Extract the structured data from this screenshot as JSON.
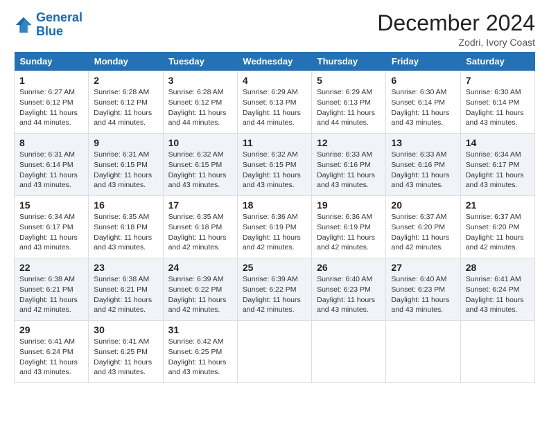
{
  "header": {
    "logo_line1": "General",
    "logo_line2": "Blue",
    "month_title": "December 2024",
    "subtitle": "Zodri, Ivory Coast"
  },
  "weekdays": [
    "Sunday",
    "Monday",
    "Tuesday",
    "Wednesday",
    "Thursday",
    "Friday",
    "Saturday"
  ],
  "weeks": [
    [
      {
        "day": "1",
        "sunrise": "6:27 AM",
        "sunset": "6:12 PM",
        "daylight": "11 hours and 44 minutes."
      },
      {
        "day": "2",
        "sunrise": "6:28 AM",
        "sunset": "6:12 PM",
        "daylight": "11 hours and 44 minutes."
      },
      {
        "day": "3",
        "sunrise": "6:28 AM",
        "sunset": "6:12 PM",
        "daylight": "11 hours and 44 minutes."
      },
      {
        "day": "4",
        "sunrise": "6:29 AM",
        "sunset": "6:13 PM",
        "daylight": "11 hours and 44 minutes."
      },
      {
        "day": "5",
        "sunrise": "6:29 AM",
        "sunset": "6:13 PM",
        "daylight": "11 hours and 44 minutes."
      },
      {
        "day": "6",
        "sunrise": "6:30 AM",
        "sunset": "6:14 PM",
        "daylight": "11 hours and 43 minutes."
      },
      {
        "day": "7",
        "sunrise": "6:30 AM",
        "sunset": "6:14 PM",
        "daylight": "11 hours and 43 minutes."
      }
    ],
    [
      {
        "day": "8",
        "sunrise": "6:31 AM",
        "sunset": "6:14 PM",
        "daylight": "11 hours and 43 minutes."
      },
      {
        "day": "9",
        "sunrise": "6:31 AM",
        "sunset": "6:15 PM",
        "daylight": "11 hours and 43 minutes."
      },
      {
        "day": "10",
        "sunrise": "6:32 AM",
        "sunset": "6:15 PM",
        "daylight": "11 hours and 43 minutes."
      },
      {
        "day": "11",
        "sunrise": "6:32 AM",
        "sunset": "6:15 PM",
        "daylight": "11 hours and 43 minutes."
      },
      {
        "day": "12",
        "sunrise": "6:33 AM",
        "sunset": "6:16 PM",
        "daylight": "11 hours and 43 minutes."
      },
      {
        "day": "13",
        "sunrise": "6:33 AM",
        "sunset": "6:16 PM",
        "daylight": "11 hours and 43 minutes."
      },
      {
        "day": "14",
        "sunrise": "6:34 AM",
        "sunset": "6:17 PM",
        "daylight": "11 hours and 43 minutes."
      }
    ],
    [
      {
        "day": "15",
        "sunrise": "6:34 AM",
        "sunset": "6:17 PM",
        "daylight": "11 hours and 43 minutes."
      },
      {
        "day": "16",
        "sunrise": "6:35 AM",
        "sunset": "6:18 PM",
        "daylight": "11 hours and 43 minutes."
      },
      {
        "day": "17",
        "sunrise": "6:35 AM",
        "sunset": "6:18 PM",
        "daylight": "11 hours and 42 minutes."
      },
      {
        "day": "18",
        "sunrise": "6:36 AM",
        "sunset": "6:19 PM",
        "daylight": "11 hours and 42 minutes."
      },
      {
        "day": "19",
        "sunrise": "6:36 AM",
        "sunset": "6:19 PM",
        "daylight": "11 hours and 42 minutes."
      },
      {
        "day": "20",
        "sunrise": "6:37 AM",
        "sunset": "6:20 PM",
        "daylight": "11 hours and 42 minutes."
      },
      {
        "day": "21",
        "sunrise": "6:37 AM",
        "sunset": "6:20 PM",
        "daylight": "11 hours and 42 minutes."
      }
    ],
    [
      {
        "day": "22",
        "sunrise": "6:38 AM",
        "sunset": "6:21 PM",
        "daylight": "11 hours and 42 minutes."
      },
      {
        "day": "23",
        "sunrise": "6:38 AM",
        "sunset": "6:21 PM",
        "daylight": "11 hours and 42 minutes."
      },
      {
        "day": "24",
        "sunrise": "6:39 AM",
        "sunset": "6:22 PM",
        "daylight": "11 hours and 42 minutes."
      },
      {
        "day": "25",
        "sunrise": "6:39 AM",
        "sunset": "6:22 PM",
        "daylight": "11 hours and 42 minutes."
      },
      {
        "day": "26",
        "sunrise": "6:40 AM",
        "sunset": "6:23 PM",
        "daylight": "11 hours and 43 minutes."
      },
      {
        "day": "27",
        "sunrise": "6:40 AM",
        "sunset": "6:23 PM",
        "daylight": "11 hours and 43 minutes."
      },
      {
        "day": "28",
        "sunrise": "6:41 AM",
        "sunset": "6:24 PM",
        "daylight": "11 hours and 43 minutes."
      }
    ],
    [
      {
        "day": "29",
        "sunrise": "6:41 AM",
        "sunset": "6:24 PM",
        "daylight": "11 hours and 43 minutes."
      },
      {
        "day": "30",
        "sunrise": "6:41 AM",
        "sunset": "6:25 PM",
        "daylight": "11 hours and 43 minutes."
      },
      {
        "day": "31",
        "sunrise": "6:42 AM",
        "sunset": "6:25 PM",
        "daylight": "11 hours and 43 minutes."
      },
      null,
      null,
      null,
      null
    ]
  ],
  "labels": {
    "sunrise": "Sunrise:",
    "sunset": "Sunset:",
    "daylight": "Daylight:"
  },
  "colors": {
    "header_bg": "#2471b5",
    "row_even": "#f0f4f8"
  }
}
